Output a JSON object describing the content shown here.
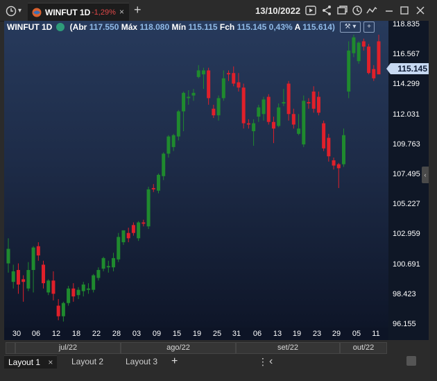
{
  "tab": {
    "title": "WINFUT 1D",
    "change": "-1,29%",
    "close_label": "×"
  },
  "toolbar": {
    "add_label": "+",
    "date": "13/10/2022",
    "icons": [
      "clock-icon",
      "caret-down-icon",
      "play-icon",
      "share-icon",
      "window-icon",
      "timer-icon",
      "trend-icon",
      "minimize-icon",
      "maximize-icon",
      "close-icon"
    ]
  },
  "info": {
    "symbol": "WINFUT 1D",
    "abr_label": "(Abr",
    "abr_value": "117.550",
    "max_label": "Máx",
    "max_value": "118.080",
    "min_label": "Mín",
    "min_value": "115.115",
    "fch_label": "Fch",
    "fch_value": "115.145",
    "pct_value": "0,43%",
    "a_label": "A",
    "a_value": "115.614)",
    "tools_label": "⚒ ▾",
    "plus_label": "+"
  },
  "colors": {
    "up": "#1f8a2e",
    "down": "#e0202a",
    "flag": "#c7d9f2"
  },
  "chart_data": {
    "type": "candlestick",
    "symbol": "WINFUT 1D",
    "last_price": 115.145,
    "last_price_label": "115.145",
    "y_ticks": [
      "118.835",
      "116.567",
      "114.299",
      "112.031",
      "109.763",
      "107.495",
      "105.227",
      "102.959",
      "100.691",
      "98.423",
      "96.155"
    ],
    "ylim": [
      96.155,
      118.835
    ],
    "x_ticks": [
      "30",
      "06",
      "12",
      "18",
      "22",
      "28",
      "03",
      "09",
      "15",
      "19",
      "25",
      "31",
      "06",
      "13",
      "19",
      "23",
      "29",
      "05",
      "11"
    ],
    "months": [
      "jul/22",
      "ago/22",
      "set/22",
      "out/22"
    ],
    "candles": [
      {
        "o": 100.8,
        "h": 102.7,
        "l": 100.1,
        "c": 101.9
      },
      {
        "o": 99.4,
        "h": 100.7,
        "l": 98.9,
        "c": 100.2
      },
      {
        "o": 100.3,
        "h": 100.8,
        "l": 98.5,
        "c": 99.2
      },
      {
        "o": 99.6,
        "h": 99.9,
        "l": 97.9,
        "c": 99.4
      },
      {
        "o": 98.9,
        "h": 100.9,
        "l": 98.7,
        "c": 100.3
      },
      {
        "o": 100.3,
        "h": 102.1,
        "l": 98.6,
        "c": 102.0
      },
      {
        "o": 102.1,
        "h": 102.4,
        "l": 101.0,
        "c": 101.4
      },
      {
        "o": 100.7,
        "h": 101.0,
        "l": 98.9,
        "c": 99.3
      },
      {
        "o": 98.6,
        "h": 99.6,
        "l": 98.4,
        "c": 99.5
      },
      {
        "o": 99.5,
        "h": 100.2,
        "l": 98.0,
        "c": 98.5
      },
      {
        "o": 97.6,
        "h": 98.1,
        "l": 96.5,
        "c": 96.8
      },
      {
        "o": 96.8,
        "h": 97.9,
        "l": 96.4,
        "c": 97.8
      },
      {
        "o": 97.8,
        "h": 99.1,
        "l": 97.6,
        "c": 98.9
      },
      {
        "o": 98.9,
        "h": 99.3,
        "l": 97.9,
        "c": 98.3
      },
      {
        "o": 98.4,
        "h": 99.0,
        "l": 98.1,
        "c": 98.8
      },
      {
        "o": 98.7,
        "h": 99.4,
        "l": 98.3,
        "c": 99.2
      },
      {
        "o": 98.8,
        "h": 99.3,
        "l": 98.5,
        "c": 98.9
      },
      {
        "o": 98.8,
        "h": 100.0,
        "l": 98.6,
        "c": 99.9
      },
      {
        "o": 99.7,
        "h": 100.5,
        "l": 99.5,
        "c": 100.3
      },
      {
        "o": 100.4,
        "h": 101.3,
        "l": 100.2,
        "c": 101.2
      },
      {
        "o": 100.5,
        "h": 101.0,
        "l": 100.1,
        "c": 100.6
      },
      {
        "o": 100.5,
        "h": 101.6,
        "l": 100.2,
        "c": 101.2
      },
      {
        "o": 101.1,
        "h": 103.1,
        "l": 100.9,
        "c": 102.8
      },
      {
        "o": 102.4,
        "h": 103.3,
        "l": 102.2,
        "c": 103.3
      },
      {
        "o": 103.1,
        "h": 103.5,
        "l": 102.4,
        "c": 102.7
      },
      {
        "o": 103.7,
        "h": 103.9,
        "l": 102.9,
        "c": 103.1
      },
      {
        "o": 102.7,
        "h": 104.0,
        "l": 102.5,
        "c": 103.9
      },
      {
        "o": 103.9,
        "h": 104.1,
        "l": 103.6,
        "c": 103.8
      },
      {
        "o": 103.6,
        "h": 106.6,
        "l": 103.4,
        "c": 106.4
      },
      {
        "o": 106.5,
        "h": 106.8,
        "l": 106.2,
        "c": 106.4
      },
      {
        "o": 106.3,
        "h": 107.6,
        "l": 106.1,
        "c": 107.5
      },
      {
        "o": 107.4,
        "h": 109.2,
        "l": 107.1,
        "c": 109.1
      },
      {
        "o": 109.1,
        "h": 110.5,
        "l": 108.8,
        "c": 110.4
      },
      {
        "o": 109.6,
        "h": 110.6,
        "l": 109.3,
        "c": 110.5
      },
      {
        "o": 110.4,
        "h": 112.4,
        "l": 110.1,
        "c": 112.3
      },
      {
        "o": 112.3,
        "h": 113.8,
        "l": 110.8,
        "c": 113.7
      },
      {
        "o": 113.3,
        "h": 113.9,
        "l": 112.8,
        "c": 113.4
      },
      {
        "o": 113.5,
        "h": 114.0,
        "l": 113.1,
        "c": 113.7
      },
      {
        "o": 114.9,
        "h": 115.8,
        "l": 114.8,
        "c": 115.4
      },
      {
        "o": 115.1,
        "h": 115.6,
        "l": 114.0,
        "c": 115.4
      },
      {
        "o": 115.4,
        "h": 115.6,
        "l": 112.8,
        "c": 113.3
      },
      {
        "o": 112.5,
        "h": 112.8,
        "l": 111.8,
        "c": 112.0
      },
      {
        "o": 112.0,
        "h": 113.5,
        "l": 111.6,
        "c": 113.3
      },
      {
        "o": 113.3,
        "h": 115.4,
        "l": 113.1,
        "c": 114.8
      },
      {
        "o": 115.2,
        "h": 115.4,
        "l": 114.6,
        "c": 115.1
      },
      {
        "o": 115.2,
        "h": 115.7,
        "l": 114.2,
        "c": 114.4
      },
      {
        "o": 114.5,
        "h": 115.2,
        "l": 113.8,
        "c": 114.1
      },
      {
        "o": 114.1,
        "h": 114.4,
        "l": 111.0,
        "c": 111.4
      },
      {
        "o": 111.4,
        "h": 111.7,
        "l": 111.0,
        "c": 111.3
      },
      {
        "o": 110.8,
        "h": 111.7,
        "l": 109.7,
        "c": 111.4
      },
      {
        "o": 111.9,
        "h": 112.8,
        "l": 111.5,
        "c": 112.6
      },
      {
        "o": 112.1,
        "h": 113.4,
        "l": 111.6,
        "c": 113.2
      },
      {
        "o": 113.4,
        "h": 113.6,
        "l": 111.3,
        "c": 111.5
      },
      {
        "o": 111.5,
        "h": 111.9,
        "l": 109.9,
        "c": 111.0
      },
      {
        "o": 111.2,
        "h": 112.9,
        "l": 111.1,
        "c": 112.6
      },
      {
        "o": 112.9,
        "h": 114.0,
        "l": 112.7,
        "c": 113.0
      },
      {
        "o": 114.4,
        "h": 114.6,
        "l": 111.6,
        "c": 112.1
      },
      {
        "o": 112.1,
        "h": 112.5,
        "l": 111.0,
        "c": 111.3
      },
      {
        "o": 110.6,
        "h": 112.1,
        "l": 110.5,
        "c": 111.0
      },
      {
        "o": 109.8,
        "h": 113.5,
        "l": 109.6,
        "c": 113.1
      },
      {
        "o": 113.0,
        "h": 113.3,
        "l": 112.5,
        "c": 112.9
      },
      {
        "o": 113.8,
        "h": 114.2,
        "l": 112.2,
        "c": 112.5
      },
      {
        "o": 113.4,
        "h": 113.8,
        "l": 112.0,
        "c": 112.2
      },
      {
        "o": 111.4,
        "h": 111.6,
        "l": 109.3,
        "c": 109.5
      },
      {
        "o": 110.3,
        "h": 110.6,
        "l": 108.5,
        "c": 108.9
      },
      {
        "o": 108.6,
        "h": 108.8,
        "l": 107.9,
        "c": 108.2
      },
      {
        "o": 108.3,
        "h": 108.4,
        "l": 106.5,
        "c": 108.0
      },
      {
        "o": 108.3,
        "h": 111.0,
        "l": 108.1,
        "c": 110.5
      },
      {
        "o": 113.8,
        "h": 117.6,
        "l": 113.3,
        "c": 116.9
      },
      {
        "o": 116.7,
        "h": 118.1,
        "l": 116.4,
        "c": 117.9
      },
      {
        "o": 116.1,
        "h": 117.6,
        "l": 115.9,
        "c": 117.5
      },
      {
        "o": 117.6,
        "h": 117.8,
        "l": 116.9,
        "c": 117.2
      },
      {
        "o": 117.2,
        "h": 117.4,
        "l": 115.1,
        "c": 115.2
      },
      {
        "o": 115.5,
        "h": 115.8,
        "l": 114.6,
        "c": 114.8
      },
      {
        "o": 117.6,
        "h": 118.1,
        "l": 115.1,
        "c": 115.1
      }
    ]
  },
  "bottom": {
    "tabs": [
      "Layout 1",
      "Layout 2",
      "Layout 3"
    ],
    "tab_close": "×",
    "add_label": "+",
    "more_label": "⋮",
    "back_label": "‹"
  }
}
